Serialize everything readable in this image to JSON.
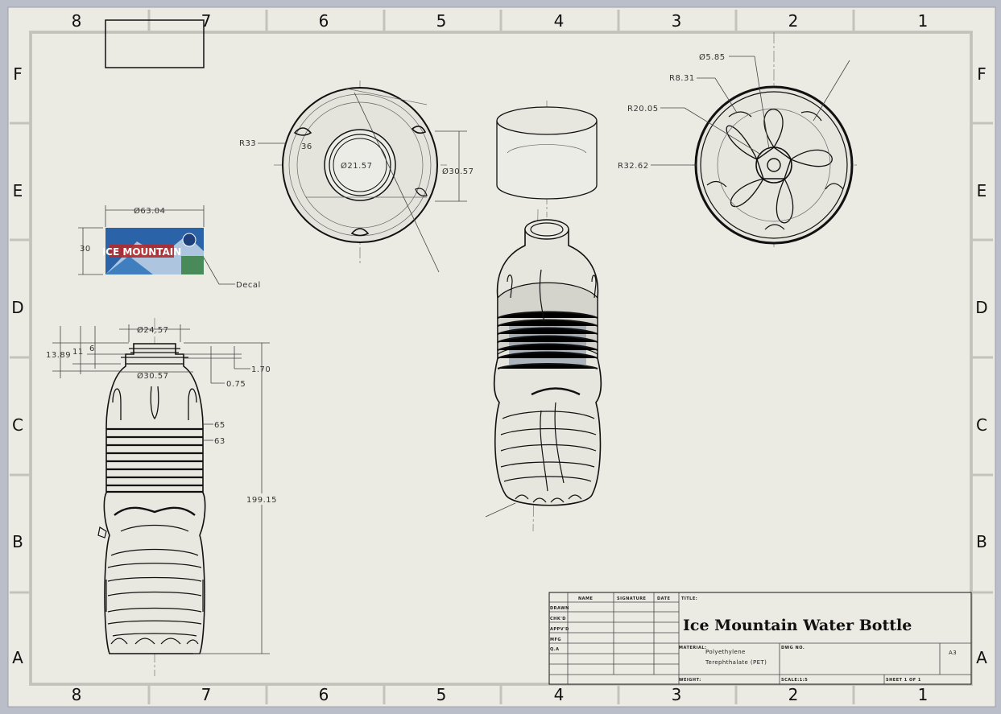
{
  "sheet": {
    "zones_horizontal": [
      "8",
      "7",
      "6",
      "5",
      "4",
      "3",
      "2",
      "1"
    ],
    "zones_vertical": [
      "F",
      "E",
      "D",
      "C",
      "B",
      "A"
    ]
  },
  "top_view_dimensions": {
    "r33": "R33",
    "r36": "36",
    "d21_57": "Ø21.57",
    "d30_57": "Ø30.57"
  },
  "bottom_view_dimensions": {
    "d5_85": "Ø5.85",
    "r8_31": "R8.31",
    "r20_05": "R20.05",
    "r32_62": "R32.62"
  },
  "decal": {
    "width_dim": "Ø63.04",
    "height_dim": "30",
    "callout": "Decal",
    "brand_text": "ICE MOUNTAIN"
  },
  "front_view_dimensions": {
    "d24_57": "Ø24.57",
    "d30_57": "Ø30.57",
    "h13_89": "13.89",
    "h11": "11",
    "h6": "6",
    "h1_70": "1.70",
    "h0_75": "0.75",
    "r65": "65",
    "r63": "63",
    "h199_15": "199.15"
  },
  "title_block": {
    "col_name": "NAME",
    "col_signature": "SIGNATURE",
    "col_date": "DATE",
    "rows": [
      "DRAWN",
      "CHK'D",
      "APPV'D",
      "MFG",
      "Q.A"
    ],
    "title_label": "TITLE:",
    "title": "Ice Mountain Water Bottle",
    "material_label": "MATERIAL:",
    "material_line1": "Polyethylene",
    "material_line2": "Terephthalate (PET)",
    "dwg_label": "DWG NO.",
    "size": "A3",
    "weight_label": "WEIGHT:",
    "scale_label": "SCALE:1:5",
    "sheet_label": "SHEET 1 OF 1"
  },
  "colors": {
    "paper": "#ebebe3",
    "frame_bg": "#b9bec8",
    "line": "#111111",
    "decal_blue": "#2a63a8",
    "decal_red": "#b32a2a"
  }
}
